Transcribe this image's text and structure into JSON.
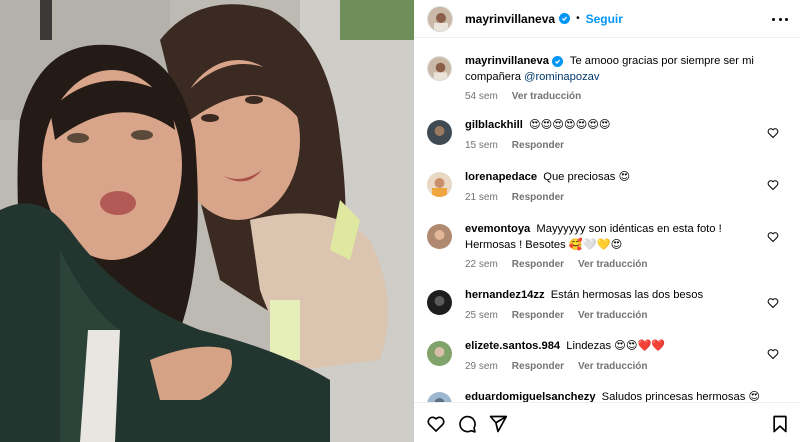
{
  "post": {
    "author": "mayrinvillaneva",
    "follow_label": "Seguir",
    "separator": "•",
    "caption": "Te amooo gracias por siempre ser mi compañera",
    "caption_mention": "@rominapozav",
    "time": "54 sem",
    "translate_label": "Ver traducción"
  },
  "comments": [
    {
      "user": "gilblackhill",
      "text": "😍😍😍😍😍😍😍",
      "time": "15 sem",
      "reply": "Responder",
      "translate": ""
    },
    {
      "user": "lorenapedace",
      "text": "Que preciosas 😍",
      "time": "21 sem",
      "reply": "Responder",
      "translate": ""
    },
    {
      "user": "evemontoya",
      "text": "Mayyyyyy son idénticas en esta foto ! Hermosas ! Besotes 🥰🤍💛😍",
      "time": "22 sem",
      "reply": "Responder",
      "translate": "Ver traducción"
    },
    {
      "user": "hernandez14zz",
      "text": "Están hermosas las dos besos",
      "time": "25 sem",
      "reply": "Responder",
      "translate": "Ver traducción"
    },
    {
      "user": "elizete.santos.984",
      "text": "Lindezas 😍😍❤️❤️",
      "time": "29 sem",
      "reply": "Responder",
      "translate": "Ver traducción"
    },
    {
      "user": "eduardomiguelsanchezy",
      "text": "Saludos princesas hermosas 😍😍",
      "time": "",
      "reply": "",
      "translate": ""
    }
  ],
  "icons": {
    "like": "heart-icon",
    "comment": "comment-icon",
    "share": "share-icon",
    "save": "bookmark-icon",
    "options": "more-options-icon",
    "verified": "verified-badge-icon"
  },
  "colors": {
    "link": "#0095f6",
    "mention": "#00376b",
    "muted": "#737373"
  }
}
